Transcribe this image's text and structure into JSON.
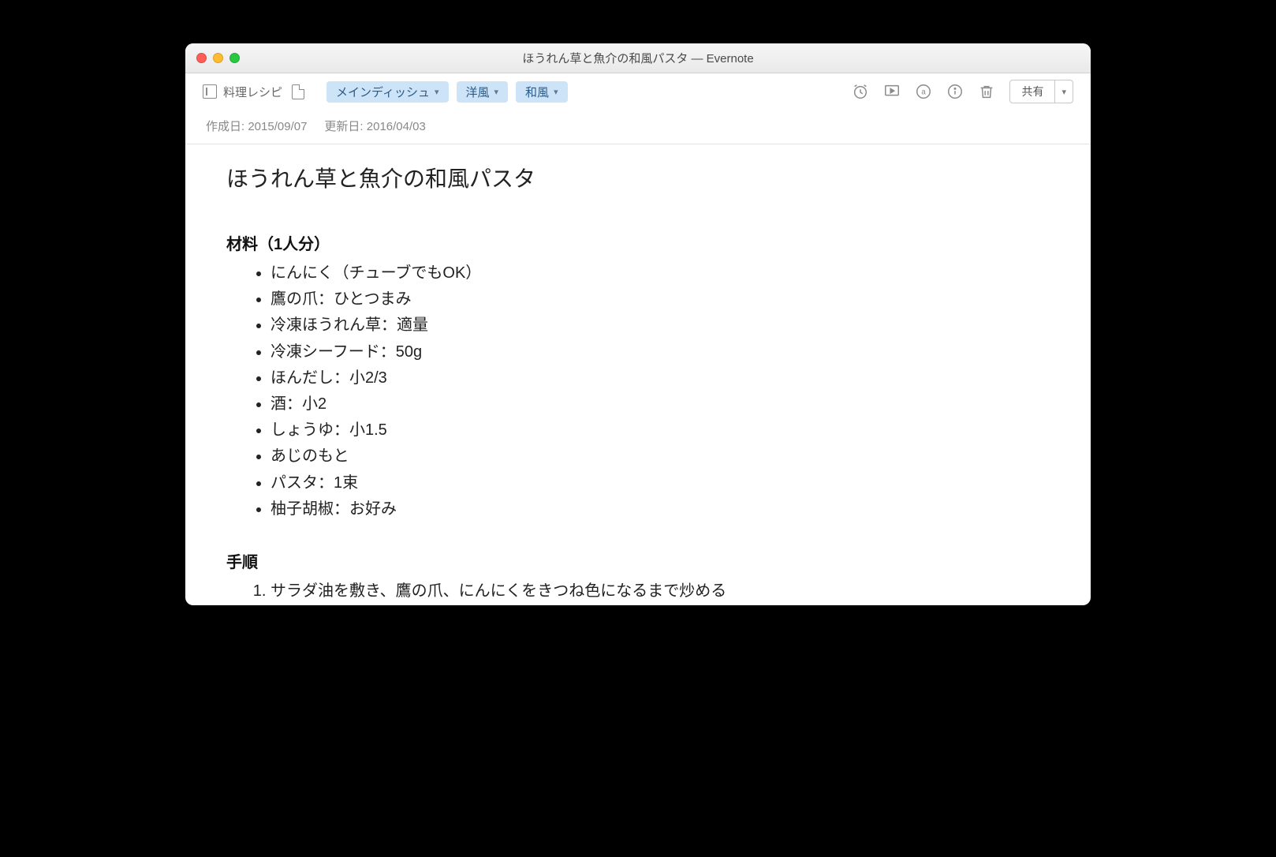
{
  "window_title": "ほうれん草と魚介の和風パスタ — Evernote",
  "toolbar": {
    "notebook_label": "料理レシピ",
    "tags": [
      "メインディッシュ",
      "洋風",
      "和風"
    ],
    "share_label": "共有"
  },
  "meta": {
    "created_label": "作成日:",
    "created_value": "2015/09/07",
    "updated_label": "更新日:",
    "updated_value": "2016/04/03"
  },
  "note": {
    "title": "ほうれん草と魚介の和風パスタ",
    "ingredients_heading": "材料（1人分）",
    "ingredients": [
      "にんにく（チューブでもOK）",
      "鷹の爪：ひとつまみ",
      "冷凍ほうれん草：適量",
      "冷凍シーフード：50g",
      "ほんだし：小2/3",
      "酒：小2",
      "しょうゆ：小1.5",
      "あじのもと",
      "パスタ：1束",
      "柚子胡椒：お好み"
    ],
    "steps_heading": "手順",
    "steps": [
      "サラダ油を敷き、鷹の爪、にんにくをきつね色になるまで炒める"
    ]
  }
}
